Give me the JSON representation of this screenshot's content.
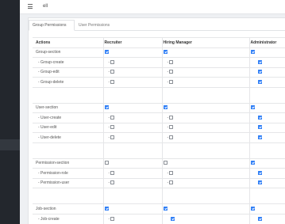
{
  "topbar": {
    "title": "ell"
  },
  "tabs": [
    {
      "label": "Group Permissions",
      "active": true
    },
    {
      "label": "User Permissions",
      "active": false
    }
  ],
  "table": {
    "headers": [
      "Actions",
      "Recruiter",
      "Hiring Manager",
      "Administrator"
    ],
    "rows": [
      {
        "type": "section",
        "label": "Group-section",
        "checks": [
          true,
          true,
          true
        ]
      },
      {
        "type": "child",
        "label": "- Group-create",
        "checks": [
          false,
          false,
          true
        ]
      },
      {
        "type": "child",
        "label": "- Group-edit",
        "checks": [
          false,
          false,
          true
        ]
      },
      {
        "type": "child",
        "label": "- Group-delete",
        "checks": [
          false,
          false,
          true
        ]
      },
      {
        "type": "spacer"
      },
      {
        "type": "section",
        "label": "User-section",
        "checks": [
          true,
          true,
          true
        ]
      },
      {
        "type": "child",
        "label": "- User-create",
        "checks": [
          false,
          false,
          true
        ]
      },
      {
        "type": "child",
        "label": "- User-edit",
        "checks": [
          false,
          false,
          true
        ]
      },
      {
        "type": "child",
        "label": "- User-delete",
        "checks": [
          false,
          false,
          true
        ]
      },
      {
        "type": "spacer"
      },
      {
        "type": "section",
        "label": "Permission-section",
        "checks": [
          false,
          false,
          true
        ]
      },
      {
        "type": "child",
        "label": "- Permission-role",
        "checks": [
          false,
          false,
          true
        ]
      },
      {
        "type": "child",
        "label": "- Permission-user",
        "checks": [
          false,
          false,
          true
        ]
      },
      {
        "type": "spacer"
      },
      {
        "type": "section",
        "label": "Job-section",
        "checks": [
          true,
          true,
          true
        ]
      },
      {
        "type": "child",
        "label": "- Job-create",
        "checks": [
          false,
          true,
          true
        ]
      }
    ]
  },
  "colors": {
    "sidebar": "#23272d",
    "checkbox_on": "#2e7ef6"
  },
  "icons": {
    "menu": "hamburger-icon"
  }
}
